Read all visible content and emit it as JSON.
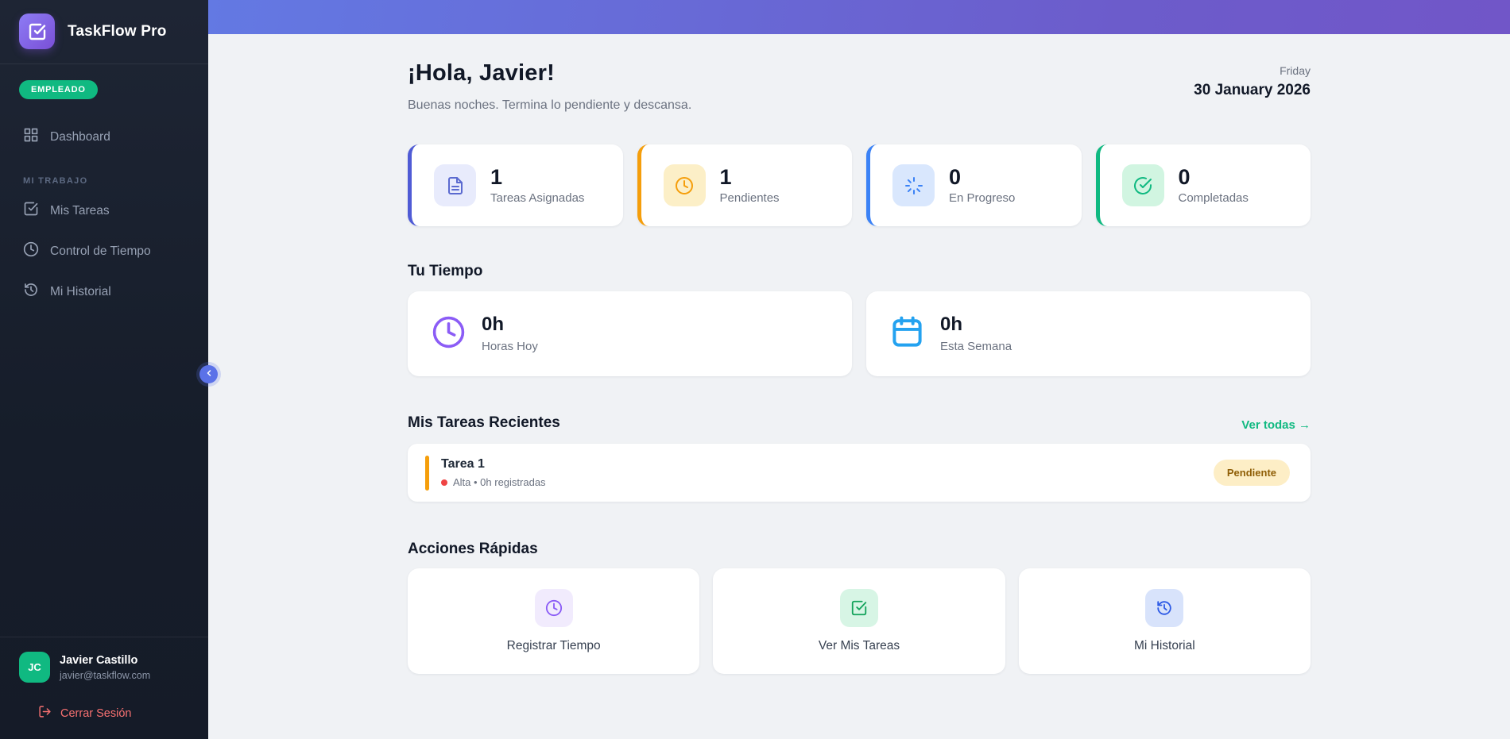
{
  "sidebar": {
    "brand": "TaskFlow Pro",
    "role_badge": "EMPLEADO",
    "nav": [
      {
        "label": "Dashboard",
        "icon": "grid-icon"
      }
    ],
    "section_label": "MI TRABAJO",
    "work_nav": [
      {
        "label": "Mis Tareas",
        "icon": "check-square-icon"
      },
      {
        "label": "Control de Tiempo",
        "icon": "clock-icon"
      },
      {
        "label": "Mi Historial",
        "icon": "history-icon"
      }
    ],
    "user": {
      "initials": "JC",
      "name": "Javier Castillo",
      "email": "javier@taskflow.com"
    },
    "logout_label": "Cerrar Sesión",
    "collapse_icon": "chevron-left-icon"
  },
  "header": {
    "greeting": "¡Hola, Javier!",
    "subtitle": "Buenas noches. Termina lo pendiente y descansa.",
    "weekday": "Friday",
    "date": "30 January 2026"
  },
  "stats": [
    {
      "value": "1",
      "label": "Tareas Asignadas",
      "icon": "file-icon",
      "accent": "#4f5bd5"
    },
    {
      "value": "1",
      "label": "Pendientes",
      "icon": "clock-icon",
      "accent": "#f59e0b"
    },
    {
      "value": "0",
      "label": "En Progreso",
      "icon": "spinner-icon",
      "accent": "#3b82f6"
    },
    {
      "value": "0",
      "label": "Completadas",
      "icon": "check-circle-icon",
      "accent": "#10b981"
    }
  ],
  "time_section": {
    "title": "Tu Tiempo",
    "cards": [
      {
        "value": "0h",
        "label": "Horas Hoy",
        "icon": "clock-icon",
        "color": "#8b5cf6"
      },
      {
        "value": "0h",
        "label": "Esta Semana",
        "icon": "calendar-icon",
        "color": "#24a2f0"
      }
    ]
  },
  "tasks_section": {
    "title": "Mis Tareas Recientes",
    "view_all": "Ver todas →",
    "tasks": [
      {
        "title": "Tarea 1",
        "meta": "Alta • 0h registradas",
        "status": "Pendiente",
        "priority_color": "#ef4444",
        "bar_color": "#f59e0b",
        "status_bg": "#fdeec6",
        "status_text_color": "#8f5e06"
      }
    ]
  },
  "actions_section": {
    "title": "Acciones Rápidas",
    "actions": [
      {
        "label": "Registrar Tiempo",
        "icon": "clock-icon",
        "color": "#8b5cf6"
      },
      {
        "label": "Ver Mis Tareas",
        "icon": "check-square-icon",
        "color": "#13a35b"
      },
      {
        "label": "Mi Historial",
        "icon": "history-icon",
        "color": "#2e5be6"
      }
    ]
  },
  "theme": {
    "sidebar_bg": "#1a2130",
    "topbar_gradient": [
      "#6379e3",
      "#7156c8"
    ],
    "page_bg": "#f0f2f5",
    "accent_green": "#10b981",
    "logout_red": "#f87171"
  }
}
